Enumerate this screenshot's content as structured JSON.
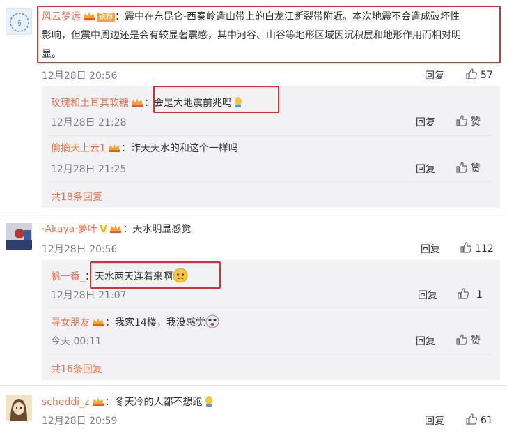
{
  "comments": [
    {
      "author": "风云梦远",
      "badge": "铁粉",
      "text_lines": [
        "：震中在东昆仑-西秦岭造山带上的白龙江断裂带附近。本次地震不会造成破坏性",
        "影响，但震中周边还是会有较显著震感，其中河谷、山谷等地形区域因沉积层和地形作用而相对明",
        "显。"
      ],
      "time": "12月28日 20:56",
      "reply_label": "回复",
      "likes": "57",
      "replies": [
        {
          "author": "玫瑰和土耳其软糖",
          "text": "：会是大地震前兆吗",
          "time": "12月28日 21:28",
          "reply_label": "回复",
          "like_label": "赞"
        },
        {
          "author": "偷摘天上云1",
          "text": "：昨天天水的和这个一样吗",
          "time": "12月28日 21:25",
          "reply_label": "回复",
          "like_label": "赞"
        }
      ],
      "more_replies": "共18条回复"
    },
    {
      "author": "·Akaya·夢叶",
      "text": "：天水明显感觉",
      "time": "12月28日 20:56",
      "reply_label": "回复",
      "likes": "112",
      "replies": [
        {
          "author": "帆一番_",
          "text": "：天水两天连着来啊",
          "time": "12月28日 21:07",
          "reply_label": "回复",
          "likes": "1"
        },
        {
          "author": "寻女朋友",
          "text": "：我家14楼，我没感觉",
          "time": "今天 00:11",
          "reply_label": "回复",
          "like_label": "赞"
        }
      ],
      "more_replies": "共16条回复"
    },
    {
      "author": "scheddi_z",
      "text": "：冬天冷的人都不想跑",
      "time": "12月28日 20:59",
      "reply_label": "回复",
      "likes": "61"
    }
  ],
  "colors": {
    "name": "#eb7350",
    "highlight_box": "#e32d2d",
    "reply_bg": "#f2f2f5"
  }
}
